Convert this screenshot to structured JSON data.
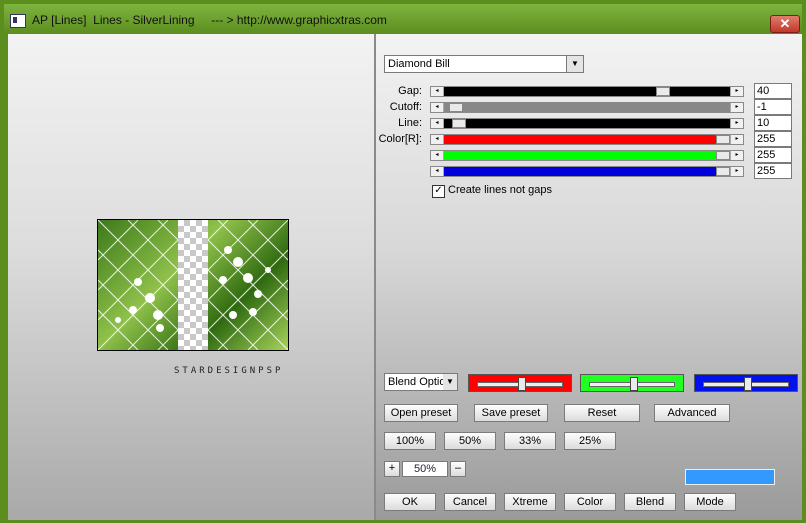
{
  "window": {
    "title": "AP [Lines]  Lines - SilverLining     --- > http://www.graphicxtras.com",
    "close_label": "✕"
  },
  "preview": {
    "watermark": "STARDESIGNPSP"
  },
  "preset": {
    "selected": "Diamond Bill"
  },
  "sliders": [
    {
      "label": "Gap:",
      "value": "40",
      "fill_color": "#000000",
      "level": 0.78
    },
    {
      "label": "Cutoff:",
      "value": "-1",
      "fill_color": "#888888",
      "level": 0.02
    },
    {
      "label": "Line:",
      "value": "10",
      "fill_color": "#000000",
      "level": 0.03
    },
    {
      "label": "Color[R]:",
      "value": "255",
      "fill_color": "#ff0000",
      "level": 1.0
    },
    {
      "label": "",
      "value": "255",
      "fill_color": "#00ff00",
      "level": 1.0
    },
    {
      "label": "",
      "value": "255",
      "fill_color": "#0000dd",
      "level": 1.0
    }
  ],
  "checkbox": {
    "label": "Create lines not gaps",
    "checked": true,
    "mark": "✓"
  },
  "blend": {
    "selected": "Blend Optio",
    "swatches": [
      {
        "color": "#ff0000",
        "level": 0.5
      },
      {
        "color": "#22ff22",
        "level": 0.5
      },
      {
        "color": "#0011ee",
        "level": 0.5
      }
    ]
  },
  "buttons": {
    "open_preset": "Open preset",
    "save_preset": "Save preset",
    "reset": "Reset",
    "advanced": "Advanced",
    "zoom_100": "100%",
    "zoom_50": "50%",
    "zoom_33": "33%",
    "zoom_25": "25%",
    "ok": "OK",
    "cancel": "Cancel",
    "xtreme": "Xtreme",
    "color": "Color",
    "blend": "Blend",
    "mode": "Mode"
  },
  "zoom": {
    "plus": "+",
    "minus": "–",
    "value": "50%"
  },
  "colors": {
    "accent_swatch": "#3399ff"
  }
}
